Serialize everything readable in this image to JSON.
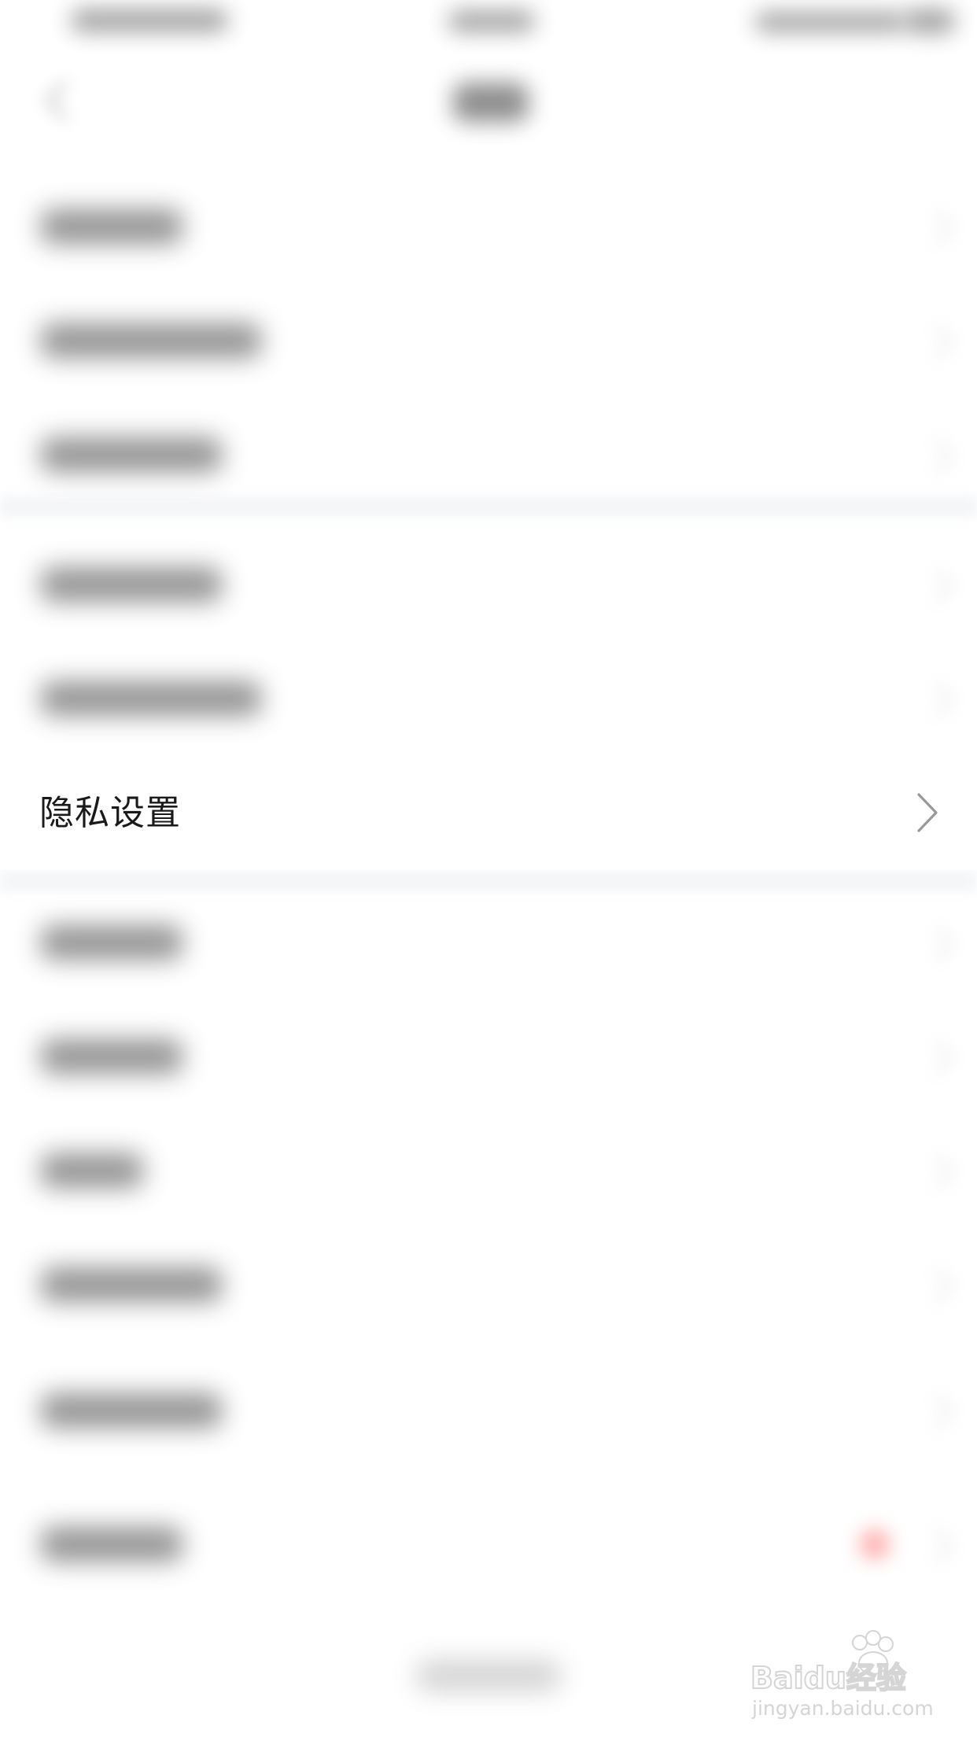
{
  "settings": {
    "items": [
      {
        "id": "privacy-settings",
        "label": "隐私设置"
      }
    ]
  },
  "watermark": {
    "brand": "Baidu经验",
    "url": "jingyan.baidu.com"
  },
  "colors": {
    "background": "#ffffff",
    "gap": "#f5f6f8",
    "text": "#1a1a1a",
    "chevron": "#999999"
  },
  "icons": {
    "back": "back-arrow-icon",
    "chevron": "chevron-right-icon"
  }
}
